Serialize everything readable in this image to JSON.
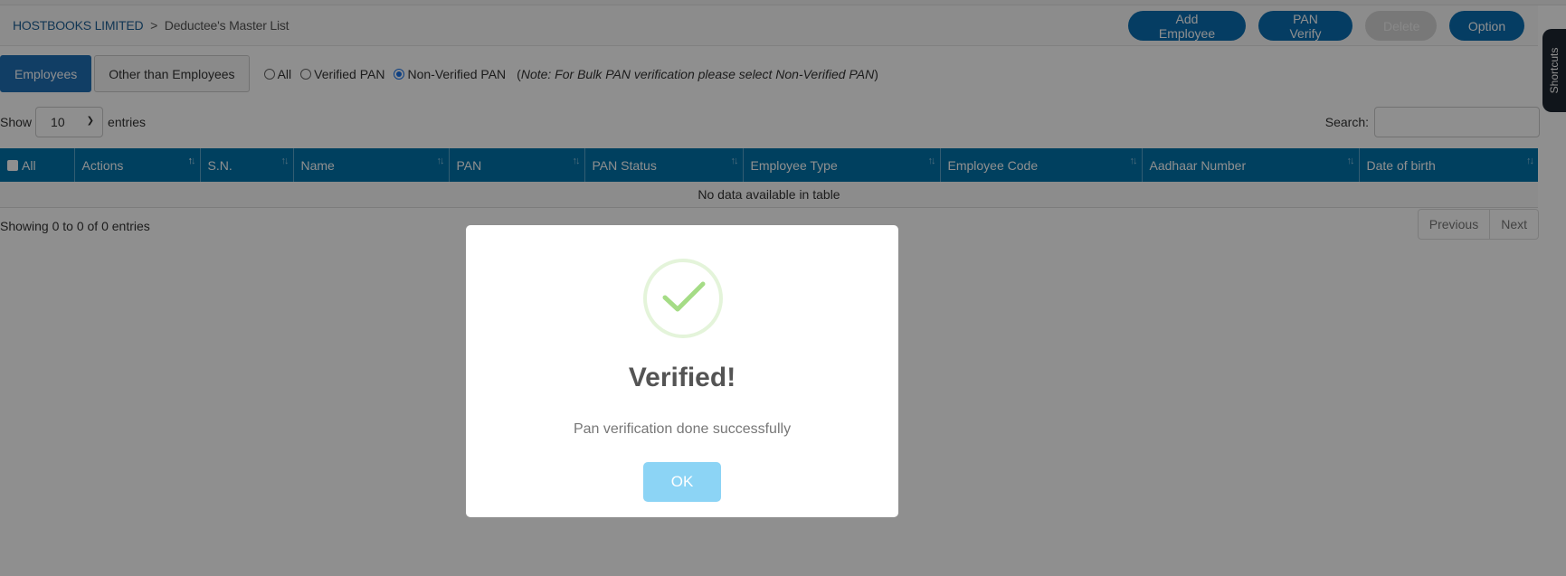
{
  "header": {
    "company": "HOSTBOOKS LIMITED",
    "separator": ">",
    "current_page": "Deductee's Master List",
    "buttons": {
      "add_employee": "Add Employee",
      "pan_verify": "PAN Verify",
      "delete": "Delete",
      "option": "Option"
    }
  },
  "tabs": [
    {
      "label": "Employees",
      "active": true
    },
    {
      "label": "Other than Employees",
      "active": false
    }
  ],
  "filters": {
    "options": [
      {
        "label": "All",
        "checked": false
      },
      {
        "label": "Verified PAN",
        "checked": false
      },
      {
        "label": "Non-Verified PAN",
        "checked": true
      }
    ],
    "note_open": "(",
    "note": "Note: For Bulk PAN verification please select Non-Verified PAN",
    "note_close": ")"
  },
  "length": {
    "show_label": "Show",
    "value": "10",
    "entries_label": "entries"
  },
  "search": {
    "label": "Search:",
    "value": "",
    "placeholder": ""
  },
  "table": {
    "columns": [
      {
        "label": "All",
        "checkbox": true
      },
      {
        "label": "Actions",
        "sorted": "asc"
      },
      {
        "label": "S.N."
      },
      {
        "label": "Name"
      },
      {
        "label": "PAN"
      },
      {
        "label": "PAN Status"
      },
      {
        "label": "Employee Type"
      },
      {
        "label": "Employee Code"
      },
      {
        "label": "Aadhaar Number"
      },
      {
        "label": "Date of birth"
      }
    ],
    "empty_message": "No data available in table",
    "info": "Showing 0 to 0 of 0 entries"
  },
  "pagination": {
    "previous": "Previous",
    "next": "Next"
  },
  "shortcuts_label": "Shortcuts",
  "modal": {
    "icon": "success-check-icon",
    "title": "Verified!",
    "message": "Pan verification done successfully",
    "ok_label": "OK"
  },
  "colors": {
    "primary": "#0a6db1",
    "table_header": "#0073a9",
    "success": "#a5dc86",
    "ok_button": "#8cd4f5"
  }
}
